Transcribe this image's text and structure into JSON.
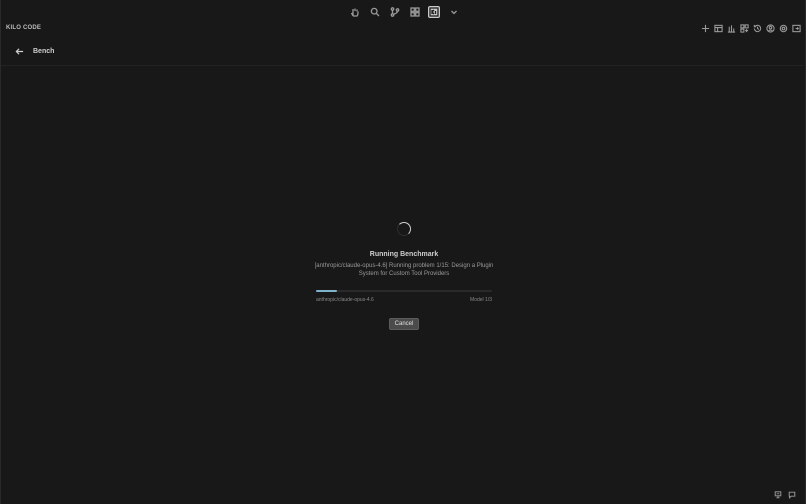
{
  "app": {
    "title": "KILO CODE"
  },
  "toolbar": {
    "icons": [
      "hand-icon",
      "search-icon",
      "branch-icon",
      "extensions-icon",
      "kilo-icon",
      "chevron-down-icon"
    ],
    "active_icon": "kilo-icon"
  },
  "header": {
    "icons": [
      "plus-icon",
      "layout-icon",
      "chart-icon",
      "marketplace-icon",
      "history-icon",
      "account-icon",
      "settings-icon",
      "popout-icon"
    ]
  },
  "bench": {
    "back_icon": "arrow-left-icon",
    "title": "Bench"
  },
  "run": {
    "title": "Running Benchmark",
    "description": "[anthropic/claude-opus-4.6] Running problem 1/15: Design a Plugin System for Custom Tool Providers",
    "progress_fraction": 0.12,
    "model_name": "anthropic/claude-opus-4.6",
    "model_counter": "Model 1/3",
    "cancel_label": "Cancel"
  },
  "footer": {
    "icons": [
      "remote-icon",
      "feedback-icon"
    ]
  },
  "colors": {
    "background": "#181818",
    "progress_fill": "#7fb3cc",
    "button_bg": "#4b4b4b"
  }
}
